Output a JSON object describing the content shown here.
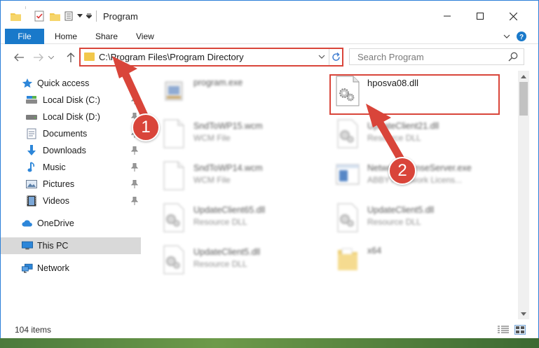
{
  "window": {
    "title": "Program",
    "quick_access_icons": [
      "folder-icon",
      "properties-icon",
      "new-folder-icon",
      "customize-icon"
    ]
  },
  "ribbon": {
    "tabs": [
      {
        "label": "File",
        "active": true
      },
      {
        "label": "Home"
      },
      {
        "label": "Share"
      },
      {
        "label": "View"
      }
    ],
    "accent_color": "#1979ca"
  },
  "navbar": {
    "address": "C:\\Program Files\\Program Directory",
    "search_placeholder": "Search Program"
  },
  "sidebar": {
    "items": [
      {
        "label": "Quick access",
        "icon": "star-icon",
        "pinned": false
      },
      {
        "label": "Local Disk (C:)",
        "icon": "drive-icon",
        "pinned": true
      },
      {
        "label": "Local Disk (D:)",
        "icon": "drive-icon",
        "pinned": true
      },
      {
        "label": "Documents",
        "icon": "documents-icon",
        "pinned": true
      },
      {
        "label": "Downloads",
        "icon": "downloads-icon",
        "pinned": true
      },
      {
        "label": "Music",
        "icon": "music-icon",
        "pinned": true
      },
      {
        "label": "Pictures",
        "icon": "pictures-icon",
        "pinned": true
      },
      {
        "label": "Videos",
        "icon": "videos-icon",
        "pinned": true
      },
      {
        "label": "OneDrive",
        "icon": "onedrive-icon"
      },
      {
        "label": "This PC",
        "icon": "this-pc-icon",
        "selected": true
      },
      {
        "label": "Network",
        "icon": "network-icon"
      }
    ]
  },
  "files": [
    {
      "name": "program.exe",
      "type": "",
      "icon": "exe-icon",
      "blurred": true
    },
    {
      "name": "hposva08.dll",
      "type": "",
      "icon": "dll-icon",
      "blurred": false,
      "highlighted": true
    },
    {
      "name": "SndToWP15.wcm",
      "type": "WCM File",
      "icon": "blank-file-icon",
      "blurred": true
    },
    {
      "name": "UpdateClient21.dll",
      "type": "Resource DLL",
      "icon": "dll-icon",
      "blurred": true
    },
    {
      "name": "SndToWP14.wcm",
      "type": "WCM File",
      "icon": "blank-file-icon",
      "blurred": true
    },
    {
      "name": "NetworkLicenseServer.exe",
      "type": "ABBYY Network Licens...",
      "icon": "app-window-icon",
      "blurred": true
    },
    {
      "name": "UpdateClient65.dll",
      "type": "Resource DLL",
      "icon": "dll-icon",
      "blurred": true
    },
    {
      "name": "UpdateClient5.dll",
      "type": "Resource DLL",
      "icon": "dll-icon",
      "blurred": true
    },
    {
      "name": "UpdateClient5.dll",
      "type": "Resource DLL",
      "icon": "dll-icon",
      "blurred": true
    },
    {
      "name": "x64",
      "type": "",
      "icon": "folder-icon",
      "blurred": true
    }
  ],
  "status": {
    "item_count": "104 items"
  },
  "annotations": {
    "step1": "1",
    "step2": "2",
    "color": "#d9453a"
  }
}
